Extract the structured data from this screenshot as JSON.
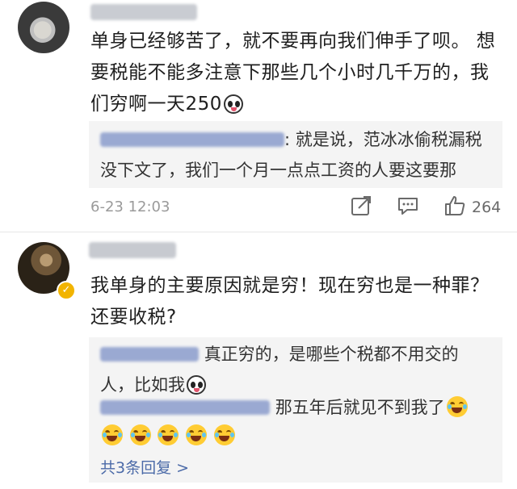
{
  "comment1": {
    "text": "单身已经够苦了，就不要再向我们伸手了呗。  想要税能不能多注意下那些几个小时几千万的，我们穷啊一天250",
    "reply": {
      "text": ": 就是说，范冰冰偷税漏税没下文了，我们一个月一点点工资的人要这要那"
    },
    "timestamp": "6-23 12:03",
    "like_count": "264"
  },
  "comment2": {
    "text": "我单身的主要原因就是穷！现在穷也是一种罪？还要收税?",
    "replies": [
      {
        "text": "真正穷的，是哪些个税都不用交的人，比如我"
      },
      {
        "text": "那五年后就见不到我了"
      }
    ],
    "more_replies": "共3条回复 >"
  },
  "icons": {
    "panda": "panda-emoji-icon",
    "laugh": "laughing-crying-emoji-icon",
    "share": "share-icon",
    "comment": "comment-icon",
    "like": "thumbs-up-icon",
    "verified": "verified-badge-icon"
  },
  "colors": {
    "link": "#4b6aa8",
    "meta": "#9a9a9a",
    "reply_bg": "#f4f4f4"
  }
}
